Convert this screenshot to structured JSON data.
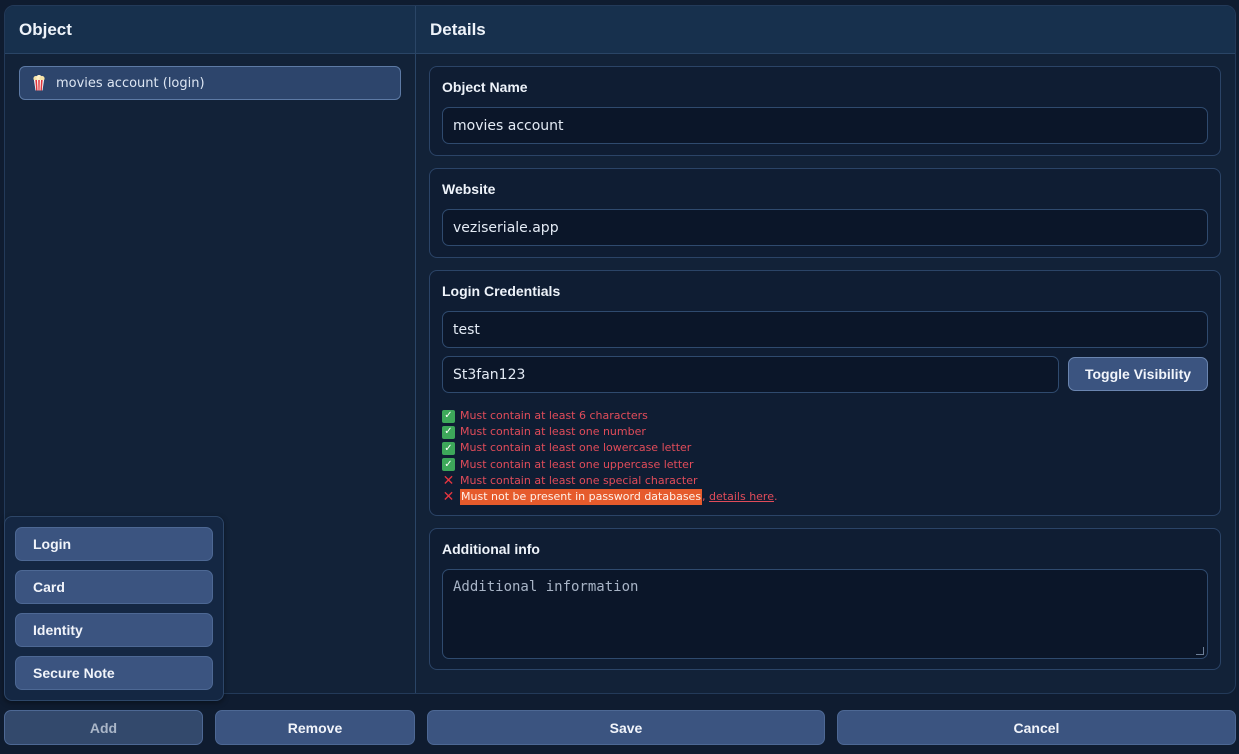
{
  "object_panel": {
    "header": "Object",
    "items": [
      {
        "label": "movies account (login)",
        "icon": "popcorn-icon"
      }
    ]
  },
  "details_panel": {
    "header": "Details",
    "object_name": {
      "label": "Object Name",
      "value": "movies account"
    },
    "website": {
      "label": "Website",
      "value": "veziseriale.app"
    },
    "credentials": {
      "label": "Login Credentials",
      "username": "test",
      "password": "St3fan123",
      "toggle_label": "Toggle Visibility",
      "rules": [
        {
          "status": "pass",
          "text": "Must contain at least 6 characters"
        },
        {
          "status": "pass",
          "text": "Must contain at least one number"
        },
        {
          "status": "pass",
          "text": "Must contain at least one lowercase letter"
        },
        {
          "status": "pass",
          "text": "Must contain at least one uppercase letter"
        },
        {
          "status": "fail",
          "text": "Must contain at least one special character"
        },
        {
          "status": "fail",
          "text": "Must not be present in password databases",
          "link_sep": ", ",
          "link_text": "details here",
          "trailing": "."
        }
      ]
    },
    "additional": {
      "label": "Additional info",
      "placeholder": "Additional information",
      "value": ""
    }
  },
  "add_menu": {
    "items": [
      "Login",
      "Card",
      "Identity",
      "Secure Note"
    ]
  },
  "footer": {
    "add": "Add",
    "remove": "Remove",
    "save": "Save",
    "cancel": "Cancel"
  },
  "colors": {
    "background": "#0f1c30",
    "button": "#3b5480",
    "error_text": "#e14c5a",
    "highlight": "#e65b2c",
    "check": "#3da85a"
  }
}
